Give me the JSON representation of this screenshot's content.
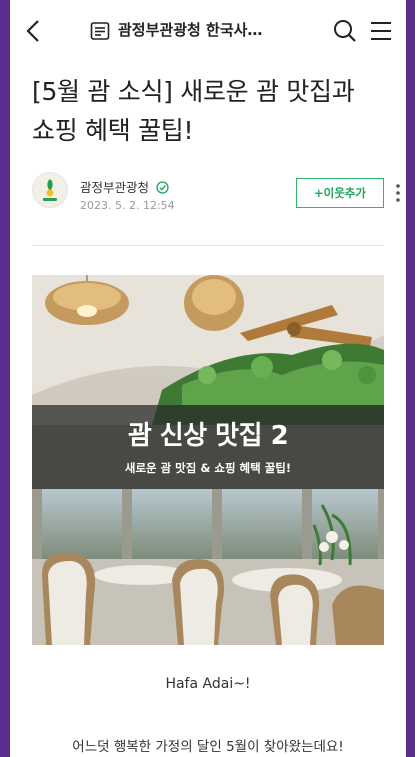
{
  "header": {
    "blog_title": "괌정부관광청 한국사…",
    "icons": [
      "back-arrow-icon",
      "blog-list-icon",
      "search-icon",
      "menu-icon"
    ]
  },
  "post": {
    "title_line1": "[5월 괌 소식] 새로운 괌 맛집과",
    "title_line2": "쇼핑 혜택 꿀팁!",
    "author": "괌정부관광청",
    "date": "2023. 5. 2. 12:54",
    "add_neighbor_label": "+이웃추가",
    "banner_title": "괌 신상 맛집 2",
    "banner_subtitle": "새로운 괌 맛집 & 쇼핑 혜택 꿀팁!",
    "greeting": "Hafa Adai~!",
    "body_line1": "어느덧 행복한 가정의 달인 5월이 찾아왔는데요!"
  },
  "colors": {
    "frame_border": "#5b2d8e",
    "accent_green": "#1fa55b"
  }
}
